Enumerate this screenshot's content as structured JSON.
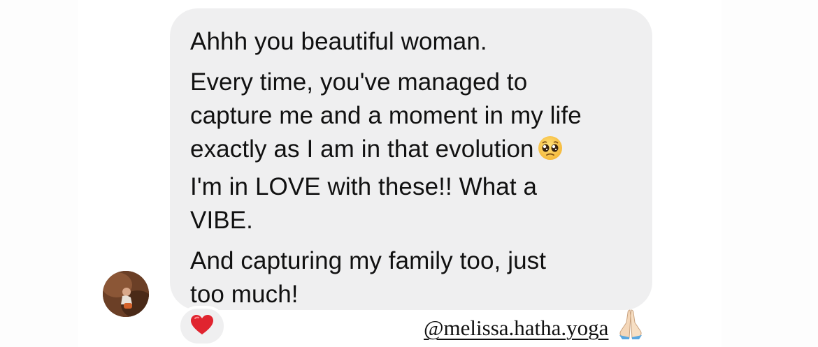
{
  "message": {
    "paragraphs": [
      {
        "lines": [
          "Ahhh you beautiful woman."
        ]
      },
      {
        "lines": [
          "Every time, you've managed to",
          "capture me and a moment in my life",
          "exactly as I am in that evolution",
          "I'm in LOVE with these!! What a",
          "VIBE."
        ]
      },
      {
        "lines": [
          "And capturing my family too, just",
          "too much!"
        ]
      }
    ],
    "inline_emoji": "pleading-face-icon"
  },
  "reaction": {
    "icon": "red-heart-icon"
  },
  "caption": {
    "mention": "@melissa.hatha.yoga",
    "emoji": "folded-hands-icon"
  },
  "colors": {
    "bubble": "#efeff0",
    "text": "#111111",
    "heart": "#e0242f"
  }
}
